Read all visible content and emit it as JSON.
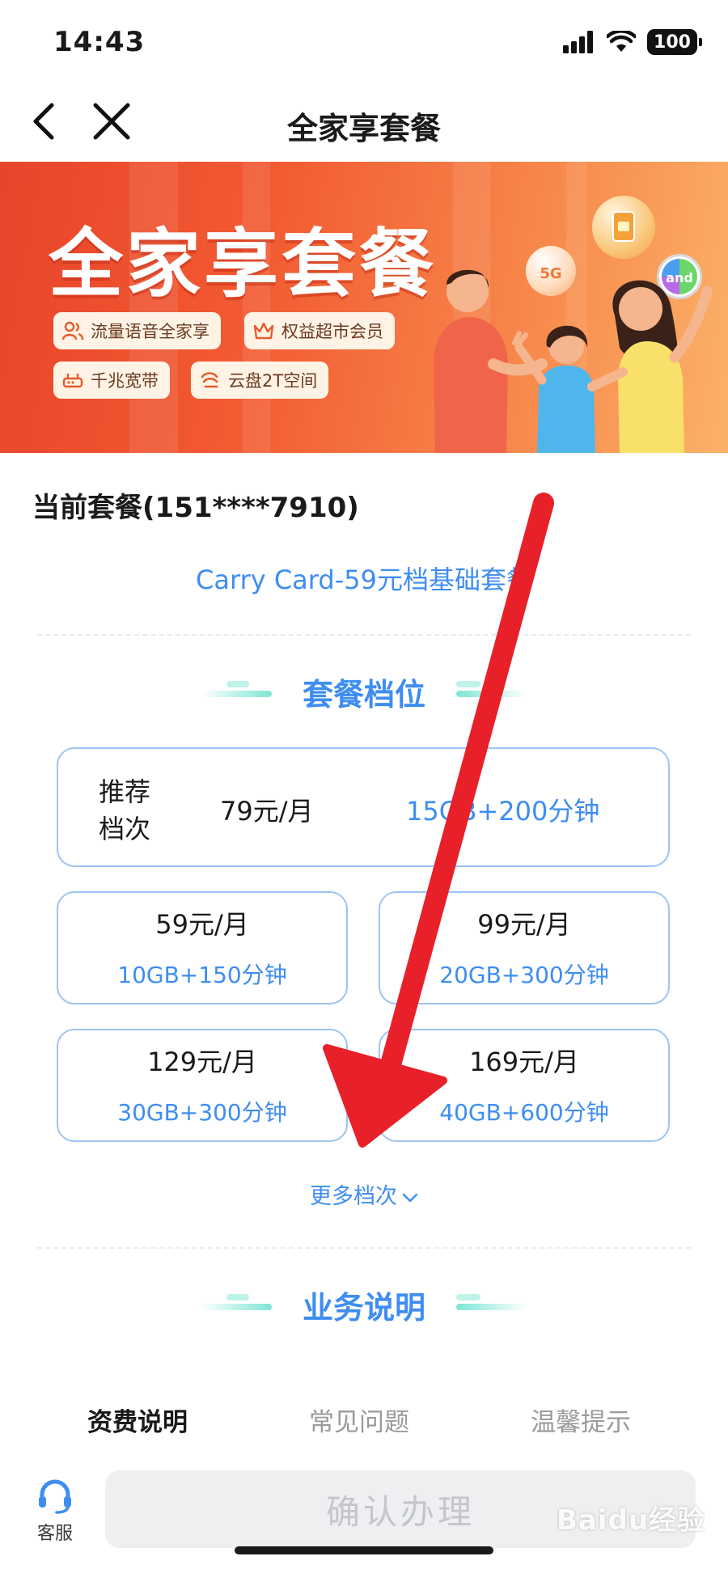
{
  "status_bar": {
    "time": "14:43",
    "battery": "100"
  },
  "nav": {
    "title": "全家享套餐"
  },
  "banner": {
    "title": "全家享套餐",
    "features": [
      {
        "label": "流量语音全家享",
        "icon": "people-icon"
      },
      {
        "label": "权益超市会员",
        "icon": "crown-icon"
      },
      {
        "label": "千兆宽带",
        "icon": "router-icon"
      },
      {
        "label": "云盘2T空间",
        "icon": "cloud-icon"
      }
    ],
    "badge_5g": "5G",
    "badge_and": "and"
  },
  "current": {
    "label": "当前套餐(151****7910)",
    "plan_name": "Carry Card-59元档基础套餐"
  },
  "tiers": {
    "heading": "套餐档位",
    "recommended": {
      "label_line1": "推荐",
      "label_line2": "档次",
      "price": "79元/月",
      "data": "15GB+200分钟"
    },
    "options": [
      {
        "price": "59元/月",
        "data": "10GB+150分钟"
      },
      {
        "price": "99元/月",
        "data": "20GB+300分钟"
      },
      {
        "price": "129元/月",
        "data": "30GB+300分钟"
      },
      {
        "price": "169元/月",
        "data": "40GB+600分钟"
      }
    ],
    "more": "更多档次"
  },
  "business": {
    "heading": "业务说明",
    "tabs": [
      "资费说明",
      "常见问题",
      "温馨提示"
    ],
    "active_tab": "资费说明"
  },
  "bottom": {
    "service_label": "客服",
    "confirm_label": "确认办理"
  },
  "watermark": "Baidu经验",
  "colors": {
    "accent": "#3e8df2",
    "banner": "#f25a32",
    "annotation_arrow": "#e8202a",
    "disabled_button": "#eeeff1"
  }
}
